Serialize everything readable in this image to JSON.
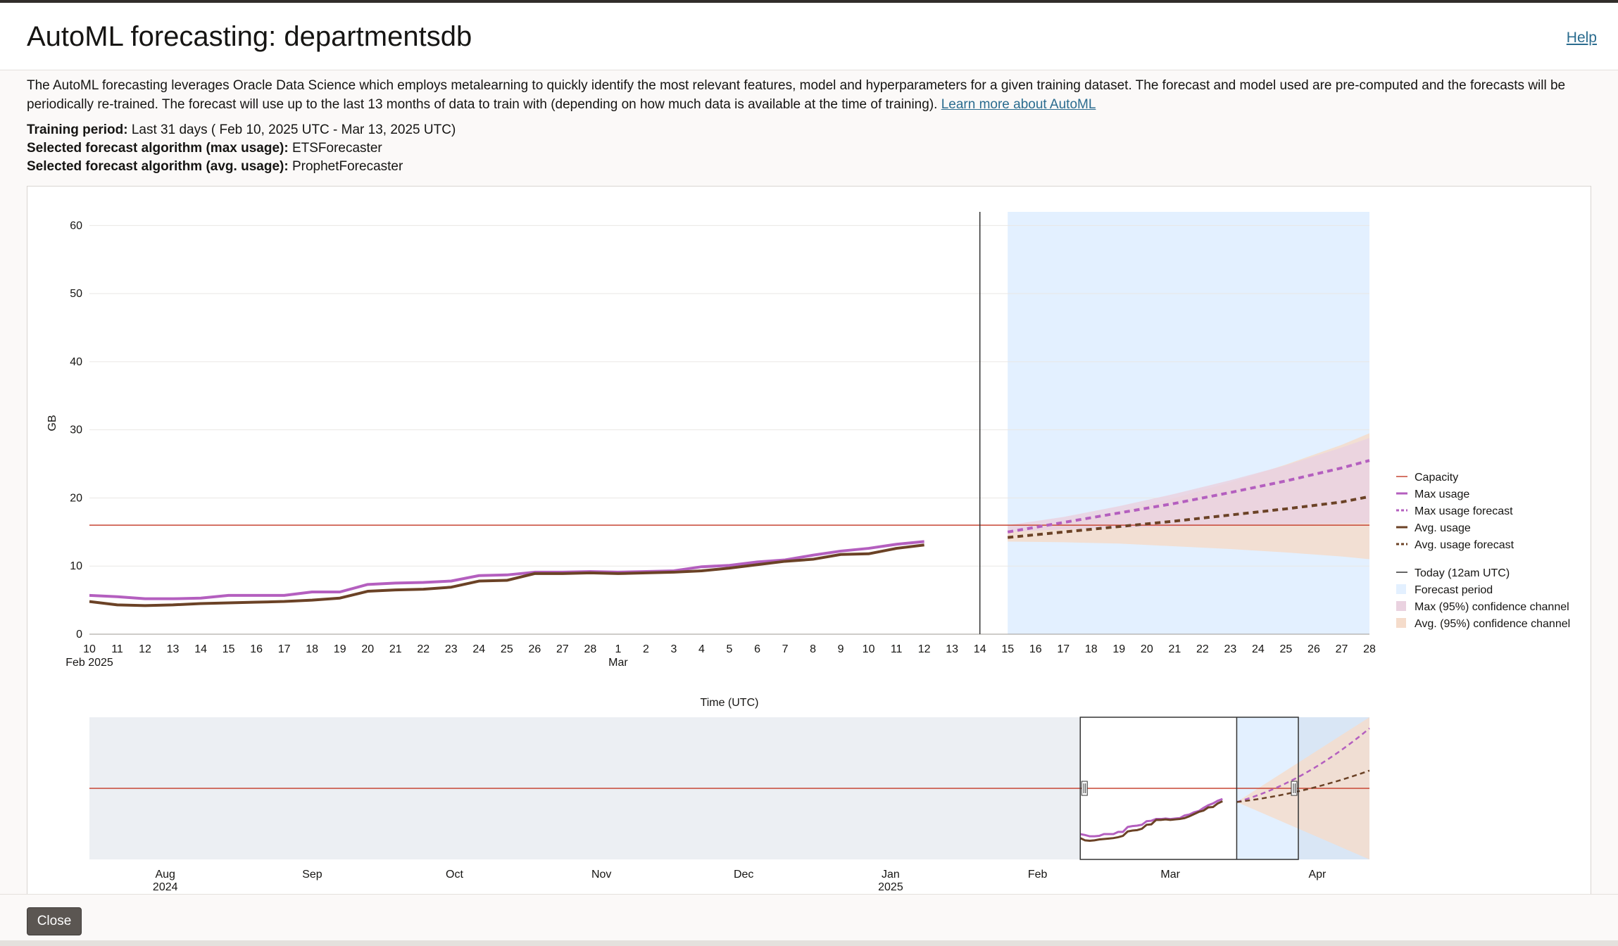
{
  "dialog": {
    "title": "AutoML forecasting: departmentsdb",
    "help_label": "Help",
    "description": "The AutoML forecasting leverages Oracle Data Science which employs metalearning to quickly identify the most relevant features, model and hyperparameters for a given training dataset. The forecast and model used are pre-computed and the forecasts will be periodically re-trained. The forecast will use up to the last 13 months of data to train with (depending on how much data is available at the time of training).",
    "learn_more_label": "Learn more about AutoML",
    "training_period_label": "Training period:",
    "training_period_value": "Last 31 days ( Feb 10, 2025 UTC - Mar 13, 2025 UTC)",
    "max_algo_label": "Selected forecast algorithm (max usage):",
    "max_algo_value": "ETSForecaster",
    "avg_algo_label": "Selected forecast algorithm (avg. usage):",
    "avg_algo_value": "ProphetForecaster",
    "close_label": "Close"
  },
  "colors": {
    "capacity": "#c74634",
    "max_usage": "#b45fbf",
    "avg_usage": "#6b4226",
    "forecast_period": "#e3f0ff",
    "max_band": "#ead2e0",
    "avg_band": "#f5dccb",
    "today": "#333333"
  },
  "chart_data": {
    "type": "line",
    "ylabel": "GB",
    "xlabel": "Time (UTC)",
    "ylim": [
      0,
      62
    ],
    "yticks": [
      0,
      10,
      20,
      30,
      40,
      50,
      60
    ],
    "x_ticks": [
      "10",
      "11",
      "12",
      "13",
      "14",
      "15",
      "16",
      "17",
      "18",
      "19",
      "20",
      "21",
      "22",
      "23",
      "24",
      "25",
      "26",
      "27",
      "28",
      "1",
      "2",
      "3",
      "4",
      "5",
      "6",
      "7",
      "8",
      "9",
      "10",
      "11",
      "12",
      "13",
      "14",
      "15",
      "16",
      "17",
      "18",
      "19",
      "20",
      "21",
      "22",
      "23",
      "24",
      "25",
      "26",
      "27",
      "28"
    ],
    "x_secondary": [
      {
        "at": "2025-02-10",
        "label": "Feb 2025"
      },
      {
        "at": "2025-03-01",
        "label": "Mar"
      }
    ],
    "x_range": [
      "2025-02-10",
      "2025-03-28"
    ],
    "capacity": 16,
    "today": "2025-03-14",
    "forecast_period": [
      "2025-03-15",
      "2025-03-28"
    ],
    "series": [
      {
        "name": "Max usage",
        "x": [
          "2025-02-10",
          "2025-02-11",
          "2025-02-12",
          "2025-02-13",
          "2025-02-14",
          "2025-02-15",
          "2025-02-16",
          "2025-02-17",
          "2025-02-18",
          "2025-02-19",
          "2025-02-20",
          "2025-02-21",
          "2025-02-22",
          "2025-02-23",
          "2025-02-24",
          "2025-02-25",
          "2025-02-26",
          "2025-02-27",
          "2025-02-28",
          "2025-03-01",
          "2025-03-02",
          "2025-03-03",
          "2025-03-04",
          "2025-03-05",
          "2025-03-06",
          "2025-03-07",
          "2025-03-08",
          "2025-03-09",
          "2025-03-10",
          "2025-03-11",
          "2025-03-12"
        ],
        "values": [
          5.7,
          5.5,
          5.2,
          5.2,
          5.3,
          5.7,
          5.7,
          5.7,
          6.2,
          6.2,
          7.3,
          7.5,
          7.6,
          7.8,
          8.6,
          8.7,
          9.1,
          9.1,
          9.2,
          9.1,
          9.2,
          9.3,
          9.9,
          10.1,
          10.6,
          10.9,
          11.6,
          12.2,
          12.6,
          13.2,
          13.6
        ]
      },
      {
        "name": "Avg. usage",
        "x": [
          "2025-02-10",
          "2025-02-11",
          "2025-02-12",
          "2025-02-13",
          "2025-02-14",
          "2025-02-15",
          "2025-02-16",
          "2025-02-17",
          "2025-02-18",
          "2025-02-19",
          "2025-02-20",
          "2025-02-21",
          "2025-02-22",
          "2025-02-23",
          "2025-02-24",
          "2025-02-25",
          "2025-02-26",
          "2025-02-27",
          "2025-02-28",
          "2025-03-01",
          "2025-03-02",
          "2025-03-03",
          "2025-03-04",
          "2025-03-05",
          "2025-03-06",
          "2025-03-07",
          "2025-03-08",
          "2025-03-09",
          "2025-03-10",
          "2025-03-11",
          "2025-03-12"
        ],
        "values": [
          4.8,
          4.3,
          4.2,
          4.3,
          4.5,
          4.6,
          4.7,
          4.8,
          5.0,
          5.3,
          6.3,
          6.5,
          6.6,
          6.9,
          7.8,
          7.9,
          8.9,
          8.9,
          9.0,
          8.9,
          9.0,
          9.1,
          9.3,
          9.7,
          10.2,
          10.7,
          11.0,
          11.7,
          11.8,
          12.6,
          13.1
        ]
      },
      {
        "name": "Max usage forecast",
        "x": [
          "2025-03-15",
          "2025-03-17",
          "2025-03-19",
          "2025-03-21",
          "2025-03-23",
          "2025-03-25",
          "2025-03-27",
          "2025-03-28"
        ],
        "values": [
          15.0,
          16.4,
          17.8,
          19.2,
          20.8,
          22.5,
          24.4,
          25.5
        ]
      },
      {
        "name": "Avg. usage forecast",
        "x": [
          "2025-03-15",
          "2025-03-17",
          "2025-03-19",
          "2025-03-21",
          "2025-03-23",
          "2025-03-25",
          "2025-03-27",
          "2025-03-28"
        ],
        "values": [
          14.2,
          15.0,
          15.8,
          16.6,
          17.5,
          18.4,
          19.4,
          20.2
        ]
      },
      {
        "name": "Max (95%) confidence channel",
        "x": [
          "2025-03-15",
          "2025-03-17",
          "2025-03-19",
          "2025-03-21",
          "2025-03-23",
          "2025-03-25",
          "2025-03-27",
          "2025-03-28"
        ],
        "lower": [
          15.0,
          15.4,
          15.6,
          15.8,
          16.0,
          16.1,
          16.2,
          16.3
        ],
        "upper": [
          16.0,
          17.2,
          18.8,
          20.6,
          22.6,
          24.8,
          27.4,
          28.8
        ]
      },
      {
        "name": "Avg. (95%) confidence channel",
        "x": [
          "2025-03-15",
          "2025-03-17",
          "2025-03-19",
          "2025-03-21",
          "2025-03-23",
          "2025-03-25",
          "2025-03-27",
          "2025-03-28"
        ],
        "lower": [
          13.6,
          13.5,
          13.3,
          12.9,
          12.5,
          12.0,
          11.4,
          11.0
        ],
        "upper": [
          15.0,
          16.4,
          18.0,
          20.0,
          22.3,
          24.9,
          27.8,
          29.5
        ]
      }
    ],
    "legend": [
      {
        "label": "Capacity",
        "style": "thin",
        "color_key": "capacity"
      },
      {
        "label": "Max usage",
        "style": "solid",
        "color_key": "max_usage"
      },
      {
        "label": "Max usage forecast",
        "style": "dashed",
        "color_key": "max_usage"
      },
      {
        "label": "Avg. usage",
        "style": "solid",
        "color_key": "avg_usage"
      },
      {
        "label": "Avg. usage forecast",
        "style": "dashed",
        "color_key": "avg_usage"
      },
      {
        "label": "Today (12am UTC)",
        "style": "thin",
        "color_key": "today"
      },
      {
        "label": "Forecast period",
        "style": "box",
        "color_key": "forecast_period"
      },
      {
        "label": "Max (95%) confidence channel",
        "style": "box",
        "color_key": "max_band"
      },
      {
        "label": "Avg. (95%) confidence channel",
        "style": "box",
        "color_key": "avg_band"
      }
    ],
    "legend_position": "right",
    "overview": {
      "x_ticks": [
        {
          "at": "2024-08-01",
          "label": "Aug",
          "sub": "2024"
        },
        {
          "at": "2024-09-01",
          "label": "Sep",
          "sub": ""
        },
        {
          "at": "2024-10-01",
          "label": "Oct",
          "sub": ""
        },
        {
          "at": "2024-11-01",
          "label": "Nov",
          "sub": ""
        },
        {
          "at": "2024-12-01",
          "label": "Dec",
          "sub": ""
        },
        {
          "at": "2025-01-01",
          "label": "Jan",
          "sub": "2025"
        },
        {
          "at": "2025-02-01",
          "label": "Feb",
          "sub": ""
        },
        {
          "at": "2025-03-01",
          "label": "Mar",
          "sub": ""
        },
        {
          "at": "2025-04-01",
          "label": "Apr",
          "sub": ""
        }
      ],
      "x_range": [
        "2024-07-16",
        "2025-04-12"
      ],
      "ylim": [
        0,
        32
      ],
      "selection": [
        "2025-02-10",
        "2025-03-28"
      ],
      "max_forecast_end": 29.5,
      "avg_forecast_end": 20.0
    }
  }
}
